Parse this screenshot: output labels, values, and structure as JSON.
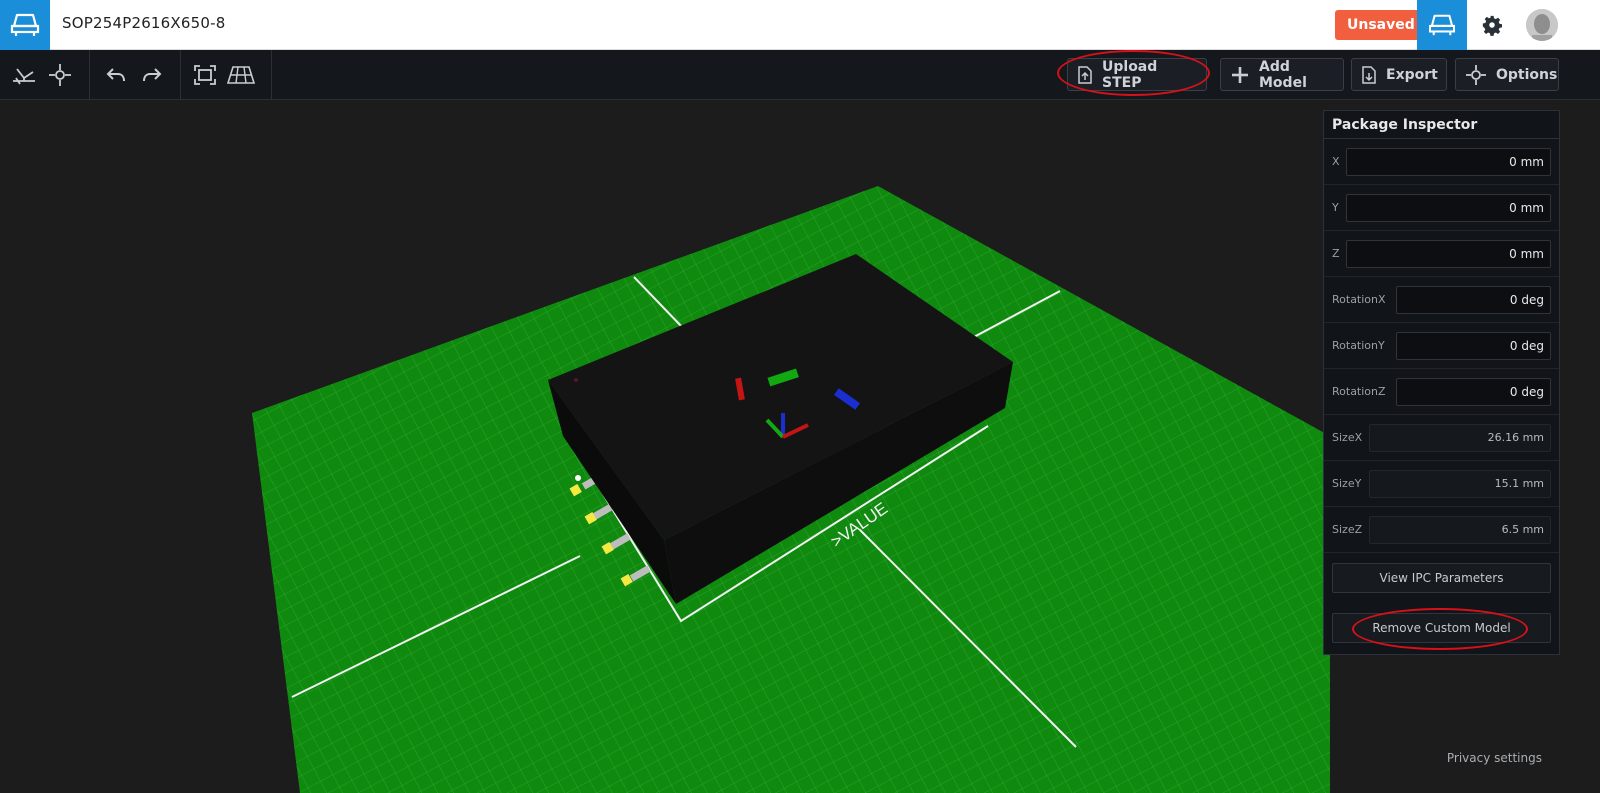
{
  "header": {
    "app_icon": "footprint-model-icon",
    "title": "SOP254P2616X650-8",
    "status_badge": "Unsaved",
    "model_view_icon": "footprint-model-icon",
    "settings_icon": "gear-icon",
    "avatar_icon": "user-avatar-icon"
  },
  "toolbar": {
    "left_icons": [
      "pcb-view-icon",
      "origin-crosshair-icon",
      "undo-icon",
      "redo-icon",
      "fit-view-icon",
      "grid-plane-icon"
    ],
    "upload_step_label": "Upload STEP",
    "add_model_label": "Add Model",
    "export_label": "Export",
    "options_label": "Options"
  },
  "viewport": {
    "silkscreen_value_label": ">VALUE",
    "board_color": "#0f8a0f",
    "privacy_label": "Privacy settings"
  },
  "inspector": {
    "title": "Package Inspector",
    "fields": [
      {
        "label": "X",
        "value": "0 mm"
      },
      {
        "label": "Y",
        "value": "0 mm"
      },
      {
        "label": "Z",
        "value": "0 mm"
      },
      {
        "label": "RotationX",
        "value": "0 deg"
      },
      {
        "label": "RotationY",
        "value": "0 deg"
      },
      {
        "label": "RotationZ",
        "value": "0 deg"
      },
      {
        "label": "SizeX",
        "value": "26.16 mm"
      },
      {
        "label": "SizeY",
        "value": "15.1 mm"
      },
      {
        "label": "SizeZ",
        "value": "6.5 mm"
      }
    ],
    "view_ipc_label": "View IPC Parameters",
    "remove_model_label": "Remove Custom Model"
  },
  "colors": {
    "accent_blue": "#1a8ed9",
    "unsaved_orange": "#f25f3f",
    "highlight_red": "#d6111a"
  }
}
